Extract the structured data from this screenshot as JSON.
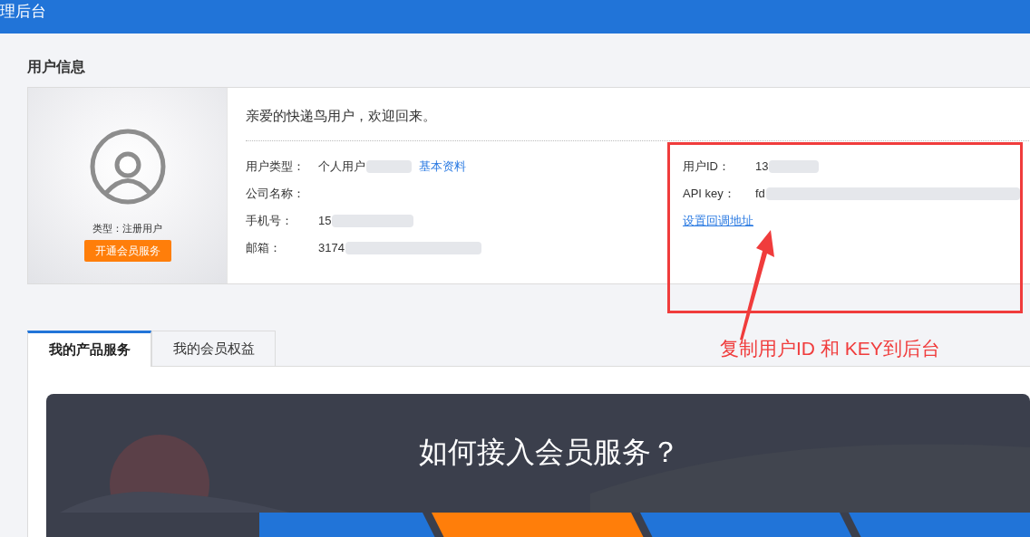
{
  "header": {
    "title": "理后台"
  },
  "section_title": "用户信息",
  "profile": {
    "type_label": "类型：注册用户",
    "upgrade_button": "开通会员服务"
  },
  "welcome": "亲爱的快递鸟用户，欢迎回来。",
  "fields_left": [
    {
      "label": "用户类型：",
      "value": "个人用户",
      "redacted": true,
      "link": "基本资料"
    },
    {
      "label": "公司名称："
    },
    {
      "label": "手机号：",
      "value": "15",
      "redacted": true
    },
    {
      "label": "邮箱：",
      "value": "3174",
      "redacted": true
    }
  ],
  "fields_right": [
    {
      "label": "用户ID：",
      "value": "13",
      "redacted": true
    },
    {
      "label": "API key：",
      "value": "fd",
      "redacted": true
    }
  ],
  "callback_link": "设置回调地址",
  "annotation": "复制用户ID 和 KEY到后台",
  "tabs": [
    {
      "label": "我的产品服务",
      "selected": true
    },
    {
      "label": "我的会员权益",
      "selected": false
    }
  ],
  "banner": {
    "title": "如何接入会员服务？"
  }
}
